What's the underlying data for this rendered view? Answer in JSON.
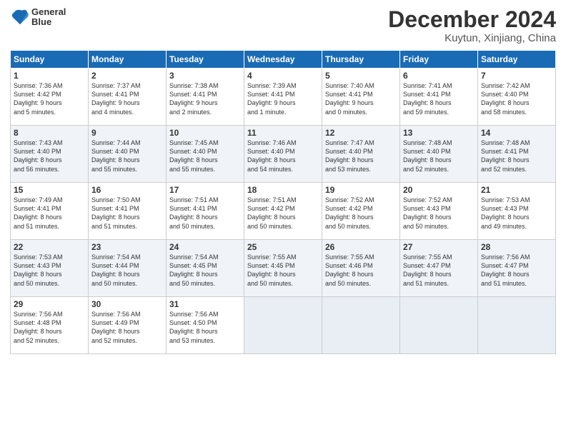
{
  "header": {
    "logo_line1": "General",
    "logo_line2": "Blue",
    "title": "December 2024",
    "subtitle": "Kuytun, Xinjiang, China"
  },
  "days_of_week": [
    "Sunday",
    "Monday",
    "Tuesday",
    "Wednesday",
    "Thursday",
    "Friday",
    "Saturday"
  ],
  "weeks": [
    [
      {
        "day": "1",
        "info": "Sunrise: 7:36 AM\nSunset: 4:42 PM\nDaylight: 9 hours\nand 5 minutes."
      },
      {
        "day": "2",
        "info": "Sunrise: 7:37 AM\nSunset: 4:41 PM\nDaylight: 9 hours\nand 4 minutes."
      },
      {
        "day": "3",
        "info": "Sunrise: 7:38 AM\nSunset: 4:41 PM\nDaylight: 9 hours\nand 2 minutes."
      },
      {
        "day": "4",
        "info": "Sunrise: 7:39 AM\nSunset: 4:41 PM\nDaylight: 9 hours\nand 1 minute."
      },
      {
        "day": "5",
        "info": "Sunrise: 7:40 AM\nSunset: 4:41 PM\nDaylight: 9 hours\nand 0 minutes."
      },
      {
        "day": "6",
        "info": "Sunrise: 7:41 AM\nSunset: 4:41 PM\nDaylight: 8 hours\nand 59 minutes."
      },
      {
        "day": "7",
        "info": "Sunrise: 7:42 AM\nSunset: 4:40 PM\nDaylight: 8 hours\nand 58 minutes."
      }
    ],
    [
      {
        "day": "8",
        "info": "Sunrise: 7:43 AM\nSunset: 4:40 PM\nDaylight: 8 hours\nand 56 minutes."
      },
      {
        "day": "9",
        "info": "Sunrise: 7:44 AM\nSunset: 4:40 PM\nDaylight: 8 hours\nand 55 minutes."
      },
      {
        "day": "10",
        "info": "Sunrise: 7:45 AM\nSunset: 4:40 PM\nDaylight: 8 hours\nand 55 minutes."
      },
      {
        "day": "11",
        "info": "Sunrise: 7:46 AM\nSunset: 4:40 PM\nDaylight: 8 hours\nand 54 minutes."
      },
      {
        "day": "12",
        "info": "Sunrise: 7:47 AM\nSunset: 4:40 PM\nDaylight: 8 hours\nand 53 minutes."
      },
      {
        "day": "13",
        "info": "Sunrise: 7:48 AM\nSunset: 4:40 PM\nDaylight: 8 hours\nand 52 minutes."
      },
      {
        "day": "14",
        "info": "Sunrise: 7:48 AM\nSunset: 4:41 PM\nDaylight: 8 hours\nand 52 minutes."
      }
    ],
    [
      {
        "day": "15",
        "info": "Sunrise: 7:49 AM\nSunset: 4:41 PM\nDaylight: 8 hours\nand 51 minutes."
      },
      {
        "day": "16",
        "info": "Sunrise: 7:50 AM\nSunset: 4:41 PM\nDaylight: 8 hours\nand 51 minutes."
      },
      {
        "day": "17",
        "info": "Sunrise: 7:51 AM\nSunset: 4:41 PM\nDaylight: 8 hours\nand 50 minutes."
      },
      {
        "day": "18",
        "info": "Sunrise: 7:51 AM\nSunset: 4:42 PM\nDaylight: 8 hours\nand 50 minutes."
      },
      {
        "day": "19",
        "info": "Sunrise: 7:52 AM\nSunset: 4:42 PM\nDaylight: 8 hours\nand 50 minutes."
      },
      {
        "day": "20",
        "info": "Sunrise: 7:52 AM\nSunset: 4:43 PM\nDaylight: 8 hours\nand 50 minutes."
      },
      {
        "day": "21",
        "info": "Sunrise: 7:53 AM\nSunset: 4:43 PM\nDaylight: 8 hours\nand 49 minutes."
      }
    ],
    [
      {
        "day": "22",
        "info": "Sunrise: 7:53 AM\nSunset: 4:43 PM\nDaylight: 8 hours\nand 50 minutes."
      },
      {
        "day": "23",
        "info": "Sunrise: 7:54 AM\nSunset: 4:44 PM\nDaylight: 8 hours\nand 50 minutes."
      },
      {
        "day": "24",
        "info": "Sunrise: 7:54 AM\nSunset: 4:45 PM\nDaylight: 8 hours\nand 50 minutes."
      },
      {
        "day": "25",
        "info": "Sunrise: 7:55 AM\nSunset: 4:45 PM\nDaylight: 8 hours\nand 50 minutes."
      },
      {
        "day": "26",
        "info": "Sunrise: 7:55 AM\nSunset: 4:46 PM\nDaylight: 8 hours\nand 50 minutes."
      },
      {
        "day": "27",
        "info": "Sunrise: 7:55 AM\nSunset: 4:47 PM\nDaylight: 8 hours\nand 51 minutes."
      },
      {
        "day": "28",
        "info": "Sunrise: 7:56 AM\nSunset: 4:47 PM\nDaylight: 8 hours\nand 51 minutes."
      }
    ],
    [
      {
        "day": "29",
        "info": "Sunrise: 7:56 AM\nSunset: 4:48 PM\nDaylight: 8 hours\nand 52 minutes."
      },
      {
        "day": "30",
        "info": "Sunrise: 7:56 AM\nSunset: 4:49 PM\nDaylight: 8 hours\nand 52 minutes."
      },
      {
        "day": "31",
        "info": "Sunrise: 7:56 AM\nSunset: 4:50 PM\nDaylight: 8 hours\nand 53 minutes."
      },
      null,
      null,
      null,
      null
    ]
  ]
}
